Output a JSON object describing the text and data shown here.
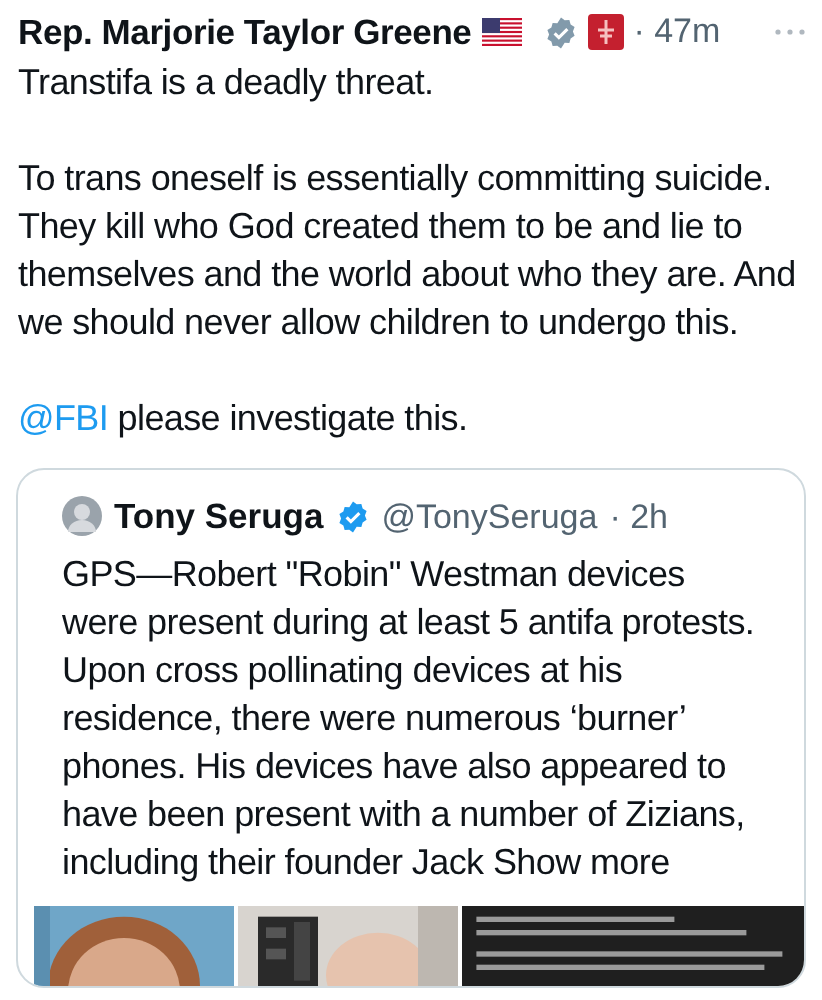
{
  "post": {
    "author": "Rep. Marjorie Taylor Greene",
    "time": "· 47m",
    "paragraphs": [
      "Transtifa is a deadly threat.",
      "To trans oneself is essentially committing suicide. They kill who God created them to be and lie to themselves and the world about who they are. And we should never allow children to undergo this."
    ],
    "mention": "@FBI",
    "mention_rest": " please investigate this.",
    "quote": {
      "author": "Tony Seruga",
      "handle": "@TonySeruga",
      "time": "· 2h",
      "text": "GPS—Robert \"Robin\" Westman devices were present during at least 5 antifa protests. Upon cross pollinating devices at his residence, there were numerous ‘burner’ phones. His devices have also appeared to have been present with a number of Zizians, including their founder Jack",
      "show_more": "Show more"
    }
  }
}
